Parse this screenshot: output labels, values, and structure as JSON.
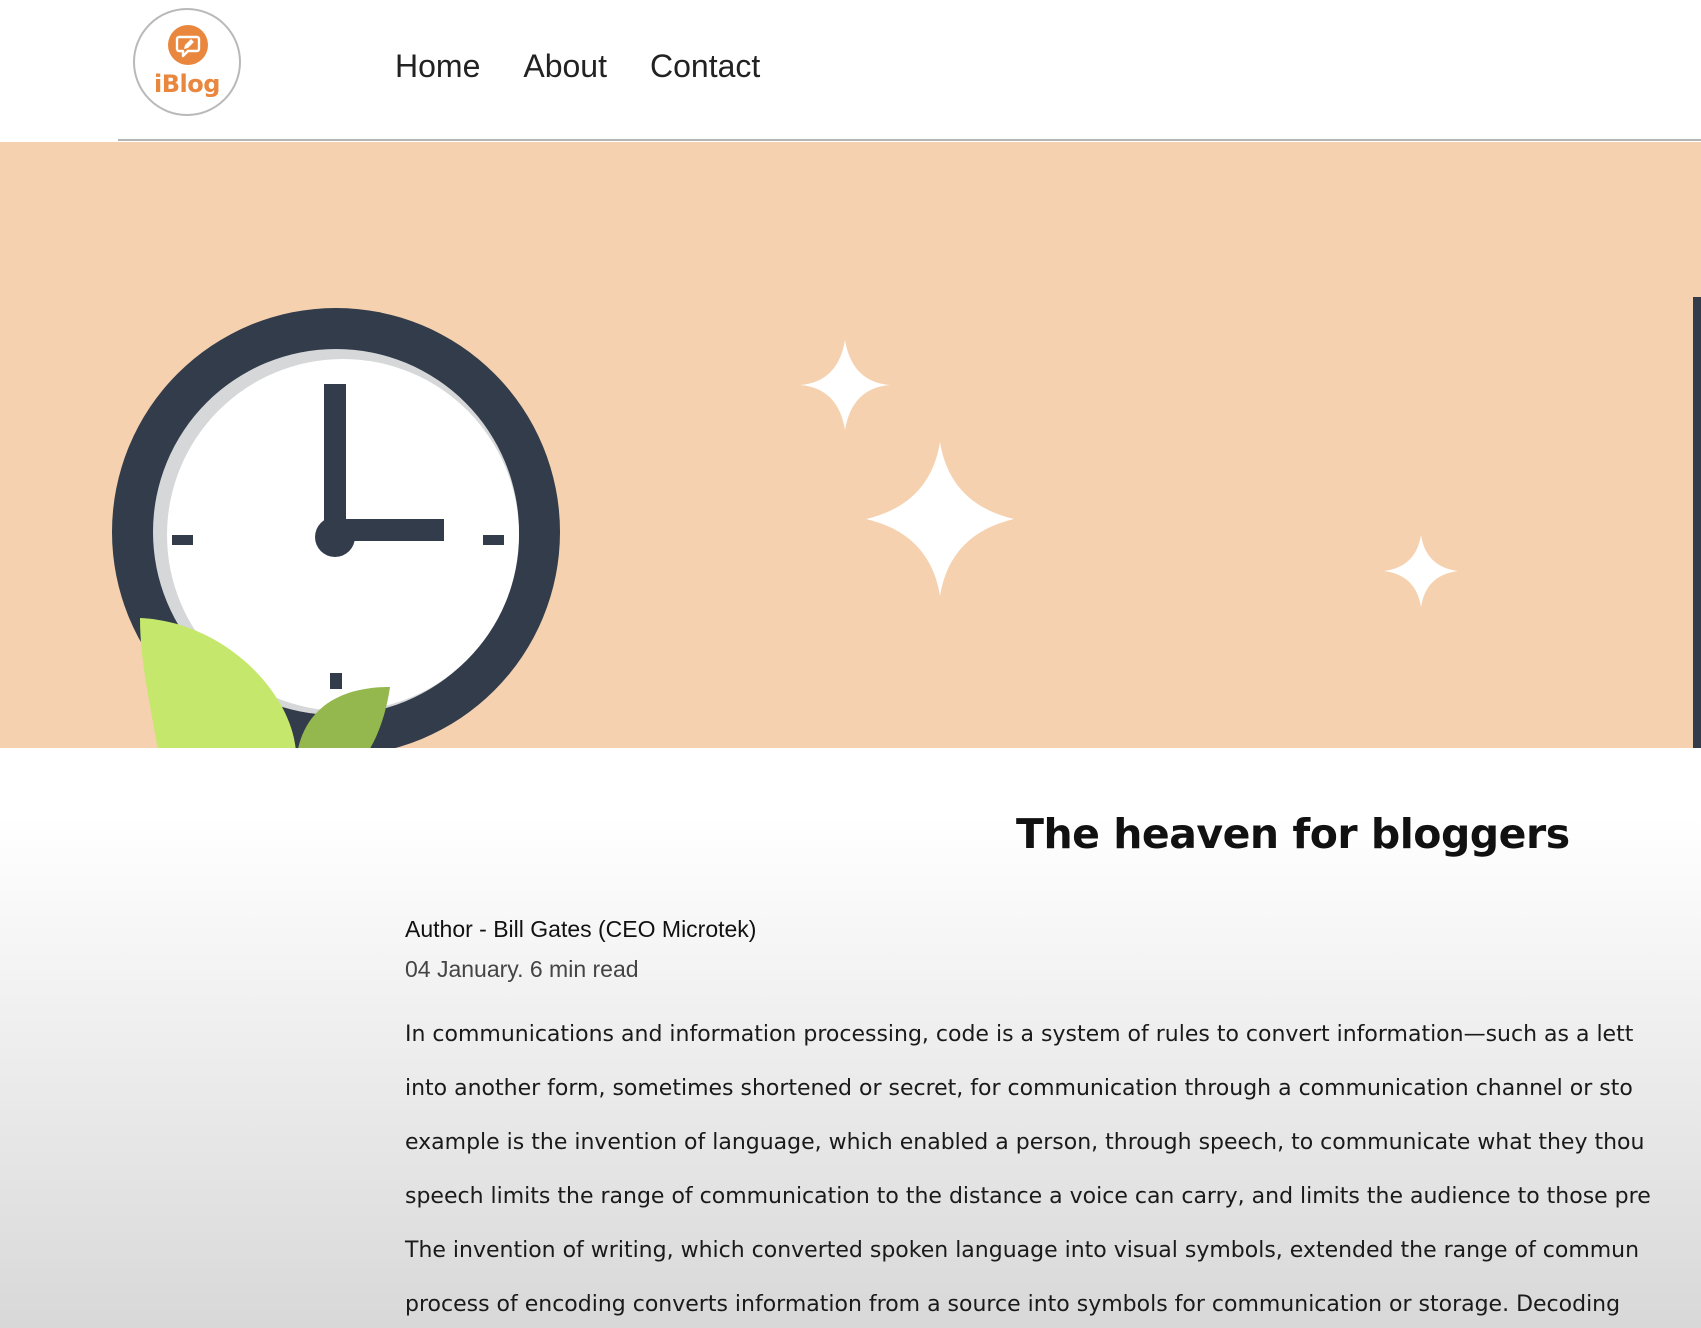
{
  "header": {
    "logo_text": "iBlog",
    "nav": [
      {
        "label": "Home"
      },
      {
        "label": "About"
      },
      {
        "label": "Contact"
      }
    ]
  },
  "hero": {
    "background_color": "#f5d1af",
    "illustration": [
      "clock-icon",
      "leaf-icon",
      "sparkle-icon"
    ]
  },
  "post": {
    "title": "The heaven for bloggers",
    "author": "Author - Bill Gates (CEO Microtek)",
    "meta": "04 January. 6 min read",
    "body_lines": [
      "In communications and information processing, code is a system of rules to convert information—such as a lett",
      "into another form, sometimes shortened or secret, for communication through a communication channel or sto",
      "example is the invention of language, which enabled a person, through speech, to communicate what they thou",
      "speech limits the range of communication to the distance a voice can carry, and limits the audience to those pre",
      "The invention of writing, which converted spoken language into visual symbols, extended the range of commun",
      "process of encoding converts information from a source into symbols for communication or storage. Decoding"
    ]
  },
  "colors": {
    "accent": "#e8873d",
    "clock_ring": "#323c4a",
    "leaf_light": "#c5e86c",
    "leaf_dark": "#94b84e"
  }
}
